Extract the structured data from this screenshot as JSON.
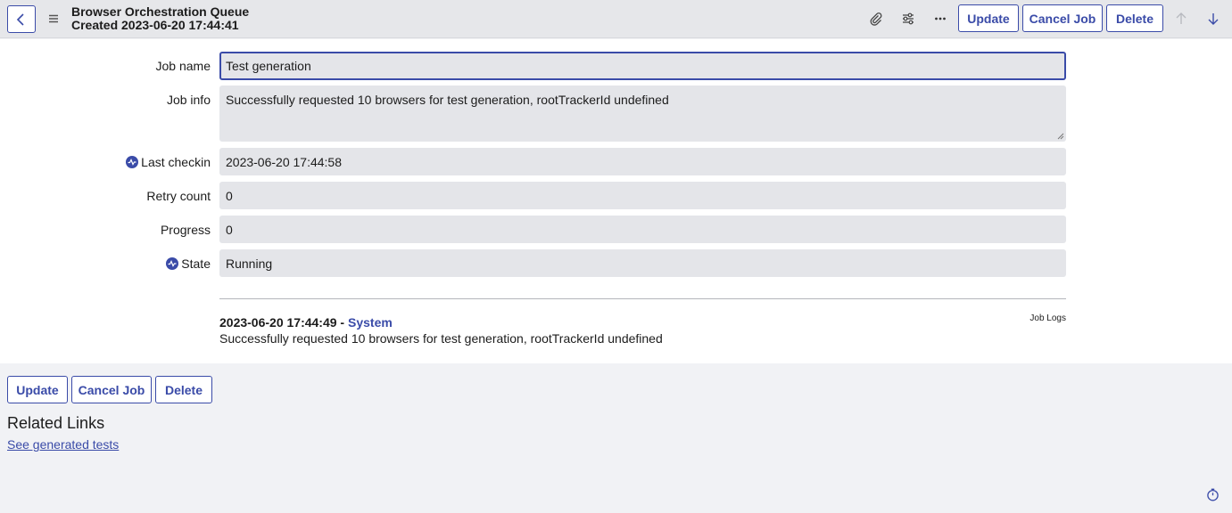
{
  "header": {
    "title": "Browser Orchestration Queue",
    "subtitle": "Created 2023-06-20 17:44:41",
    "icons": [
      "back-icon",
      "menu-icon",
      "paperclip-icon",
      "sliders-icon",
      "more-icon",
      "arrow-up-icon",
      "arrow-down-icon"
    ],
    "update_label": "Update",
    "cancel_label": "Cancel Job",
    "delete_label": "Delete"
  },
  "form": {
    "fields": [
      {
        "label": "Job name",
        "value": "Test generation"
      },
      {
        "label": "Job info",
        "value": "Successfully requested 10 browsers for test generation, rootTrackerId undefined"
      },
      {
        "label": "Last checkin",
        "value": "2023-06-20 17:44:58"
      },
      {
        "label": "Retry count",
        "value": "0"
      },
      {
        "label": "Progress",
        "value": "0"
      },
      {
        "label": "State",
        "value": "Running"
      }
    ]
  },
  "journal": {
    "title": "Job Logs",
    "entries": [
      {
        "timestamp": "2023-06-20 17:44:49",
        "separator": " - ",
        "user": "System",
        "text": "Successfully requested 10 browsers for test generation, rootTrackerId undefined"
      }
    ]
  },
  "footer_buttons": {
    "update_label": "Update",
    "cancel_label": "Cancel Job",
    "delete_label": "Delete"
  },
  "related": {
    "title": "Related Links",
    "links": [
      "See generated tests"
    ]
  },
  "colors": {
    "accent": "#3a4ba8",
    "header_bg": "#e6e7ea",
    "field_bg": "#e4e5e9",
    "page_bg": "#f1f2f5"
  }
}
